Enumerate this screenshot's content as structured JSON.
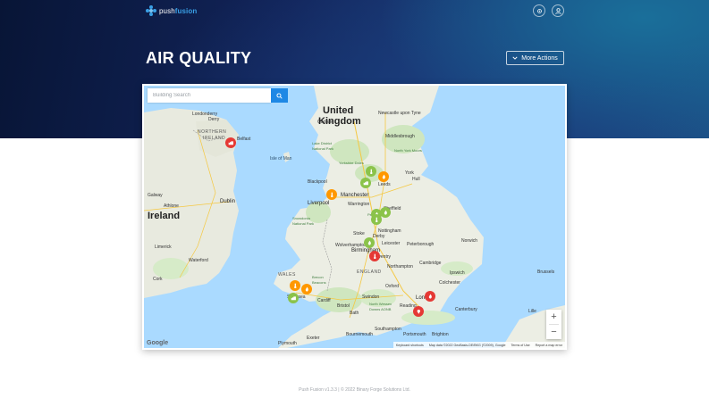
{
  "header": {
    "logo_prefix": "push",
    "logo_suffix": "fusion",
    "accent": "#3aa0e6",
    "icons": [
      "settings-icon",
      "user-icon"
    ]
  },
  "page": {
    "title": "AIR QUALITY",
    "more_actions_label": "More Actions"
  },
  "map": {
    "search_placeholder": "Building Search",
    "labels": {
      "united_kingdom_1": "United",
      "united_kingdom_2": "Kingdom",
      "ireland": "Ireland",
      "northern_ireland_1": "NORTHERN",
      "northern_ireland_2": "IRELAND",
      "wales": "WALES",
      "england": "ENGLAND",
      "isle_of_man": "Isle of Man",
      "belfast": "Belfast",
      "londonderry_1": "Londonderry",
      "londonderry_2": "Derry",
      "dublin": "Dublin",
      "manchester": "Manchester",
      "liverpool": "Liverpool",
      "birmingham": "Birmingham",
      "london": "London",
      "leeds": "Leeds",
      "sheffield": "Sheffield",
      "nottingham": "Nottingham",
      "leicester": "Leicester",
      "peterborough": "Peterborough",
      "norwich": "Norwich",
      "cambridge": "Cambridge",
      "cardiff": "Cardiff",
      "swansea": "Swansea",
      "bristol": "Bristol",
      "southampton": "Southampton",
      "exeter": "Exeter",
      "plymouth": "Plymouth",
      "newcastle": "Newcastle upon Tyne",
      "middlesbrough": "Middlesbrough",
      "york": "York",
      "hull": "Hull",
      "blackpool": "Blackpool",
      "warrington": "Warrington",
      "derby": "Derby",
      "stoke": "Stoke",
      "wolverhampton": "Wolverhampton",
      "coventry": "Coventry",
      "northampton": "Northampton",
      "oxford": "Oxford",
      "reading": "Reading",
      "swindon": "Swindon",
      "bath": "Bath",
      "ipswich": "Ipswich",
      "colchester": "Colchester",
      "canterbury": "Canterbury",
      "brighton": "Brighton",
      "portsmouth": "Portsmouth",
      "bournemouth": "Bournemouth",
      "galway": "Galway",
      "limerick": "Limerick",
      "cork": "Cork",
      "waterford": "Waterford",
      "athlone": "Athlone",
      "carlisle": "Carlisle",
      "lake_district_1": "Lake District",
      "lake_district_2": "National Park",
      "snowdonia_1": "Snowdonia",
      "snowdonia_2": "National Park",
      "north_york_moors": "North York Moors",
      "yorkshire_dales": "Yorkshire Dales",
      "peak_district": "Peak District",
      "brecon_1": "Brecon",
      "brecon_2": "Beacons",
      "north_wessex_1": "North Wessex",
      "north_wessex_2": "Downs AONB",
      "lille": "Lille",
      "brussels": "Brussels"
    },
    "zoom_in": "+",
    "zoom_out": "−",
    "google": "Google",
    "attribution": {
      "keyboard": "Keyboard shortcuts",
      "map_data": "Map data ©2022 GeoBasis-DE/BKG (©2009), Google",
      "terms": "Terms of Use",
      "report": "Report a map error"
    },
    "marker_colors": {
      "good": "#8bc34a",
      "moderate": "#ff9800",
      "poor": "#e53935"
    }
  },
  "footer": {
    "text": "Push Fusion v1.3.3 | © 2022 Binary Forge Solutions Ltd."
  }
}
